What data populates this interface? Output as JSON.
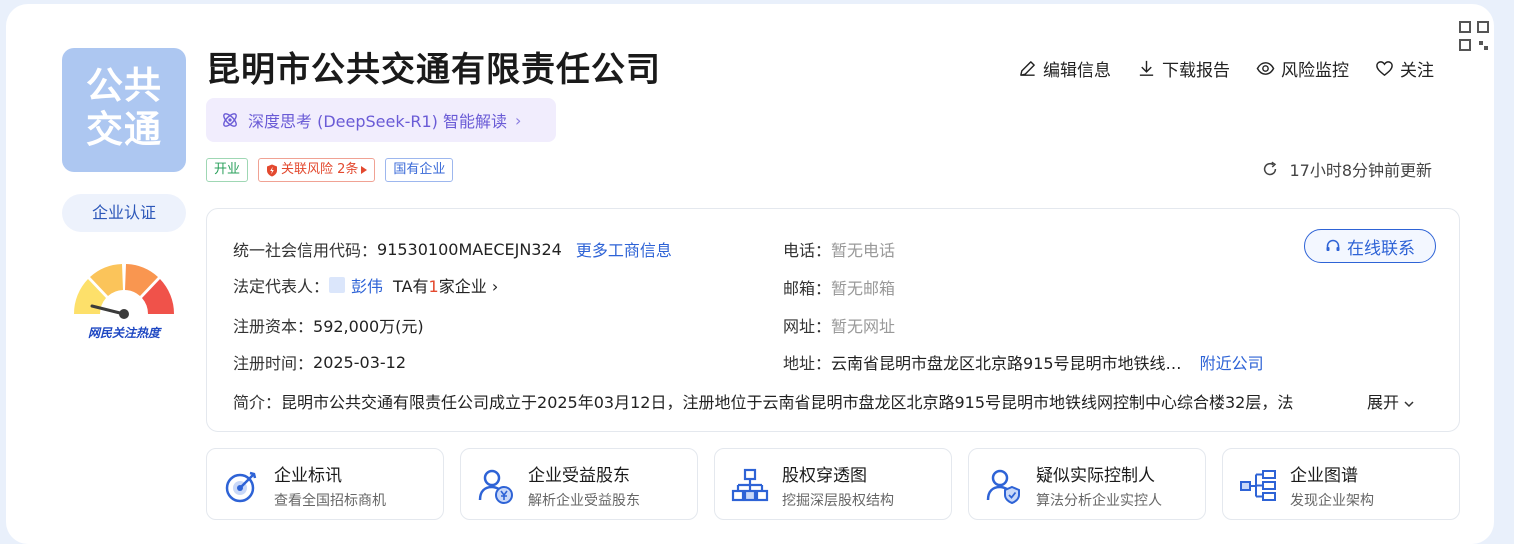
{
  "company": {
    "logo_text": [
      "公共",
      "交通"
    ],
    "name": "昆明市公共交通有限责任公司",
    "certification_label": "企业认证",
    "heat_label": "网民关注热度"
  },
  "ai": {
    "label": "深度思考 (DeepSeek-R1) 智能解读"
  },
  "tags": [
    {
      "label": "开业",
      "style": "green"
    },
    {
      "label": "关联风险 2条",
      "style": "red"
    },
    {
      "label": "国有企业",
      "style": "blue"
    }
  ],
  "actions": {
    "edit": "编辑信息",
    "download": "下载报告",
    "monitor": "风险监控",
    "follow": "关注"
  },
  "updated": "17小时8分钟前更新",
  "info": {
    "credit_code_label": "统一社会信用代码：",
    "credit_code": "91530100MAECEJN324",
    "more_info": "更多工商信息",
    "legal_rep_label": "法定代表人：",
    "legal_rep": "彭伟",
    "ta_prefix": "TA有",
    "ta_count": "1",
    "ta_suffix": "家企业",
    "capital_label": "注册资本：",
    "capital": "592,000万(元)",
    "reg_date_label": "注册时间：",
    "reg_date": "2025-03-12",
    "phone_label": "电话：",
    "phone": "暂无电话",
    "email_label": "邮箱：",
    "email": "暂无邮箱",
    "website_label": "网址：",
    "website": "暂无网址",
    "address_label": "地址：",
    "address": "云南省昆明市盘龙区北京路915号昆明市地铁线…",
    "nearby": "附近公司",
    "contact_button": "在线联系",
    "intro_label": "简介：",
    "intro": "昆明市公共交通有限责任公司成立于2025年03月12日，注册地位于云南省昆明市盘龙区北京路915号昆明市地铁线网控制中心综合楼32层，法",
    "expand": "展开"
  },
  "features": [
    {
      "title": "企业标讯",
      "subtitle": "查看全国招标商机",
      "icon": "target-icon"
    },
    {
      "title": "企业受益股东",
      "subtitle": "解析企业受益股东",
      "icon": "beneficiary-icon"
    },
    {
      "title": "股权穿透图",
      "subtitle": "挖掘深层股权结构",
      "icon": "org-tree-icon"
    },
    {
      "title": "疑似实际控制人",
      "subtitle": "算法分析企业实控人",
      "icon": "controller-icon"
    },
    {
      "title": "企业图谱",
      "subtitle": "发现企业架构",
      "icon": "graph-icon"
    }
  ],
  "colors": {
    "accent_blue": "#2e63d6",
    "ai_purple": "#6a5bd6",
    "risk_red": "#e3492f",
    "open_green": "#2aa05b"
  }
}
